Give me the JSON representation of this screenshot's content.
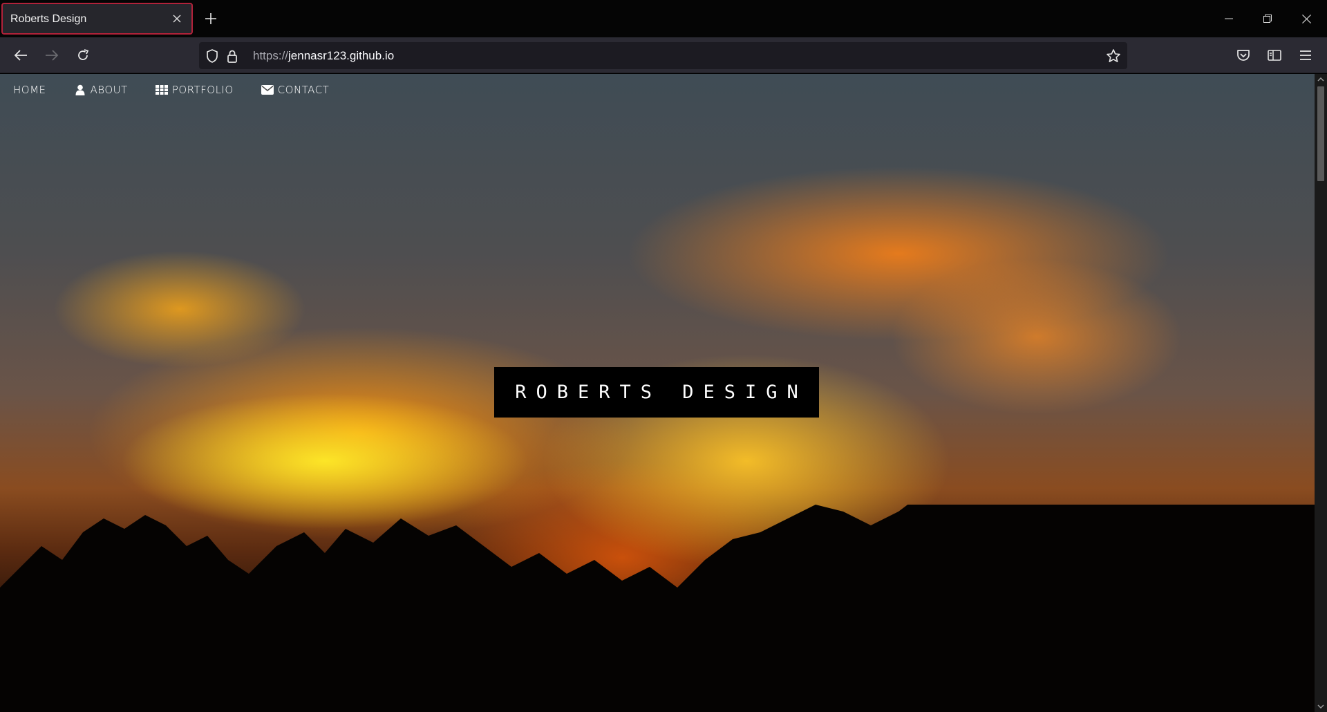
{
  "browser": {
    "tab": {
      "title": "Roberts Design"
    },
    "url": {
      "protocol": "https://",
      "host": "jennasr123.github.io"
    },
    "accent_color": "#b2223a"
  },
  "site": {
    "nav": [
      {
        "label": "HOME",
        "icon": ""
      },
      {
        "label": "ABOUT",
        "icon": "user-icon"
      },
      {
        "label": "PORTFOLIO",
        "icon": "grid-icon"
      },
      {
        "label": "CONTACT",
        "icon": "envelope-icon"
      }
    ],
    "hero_title": "ROBERTS DESIGN"
  }
}
